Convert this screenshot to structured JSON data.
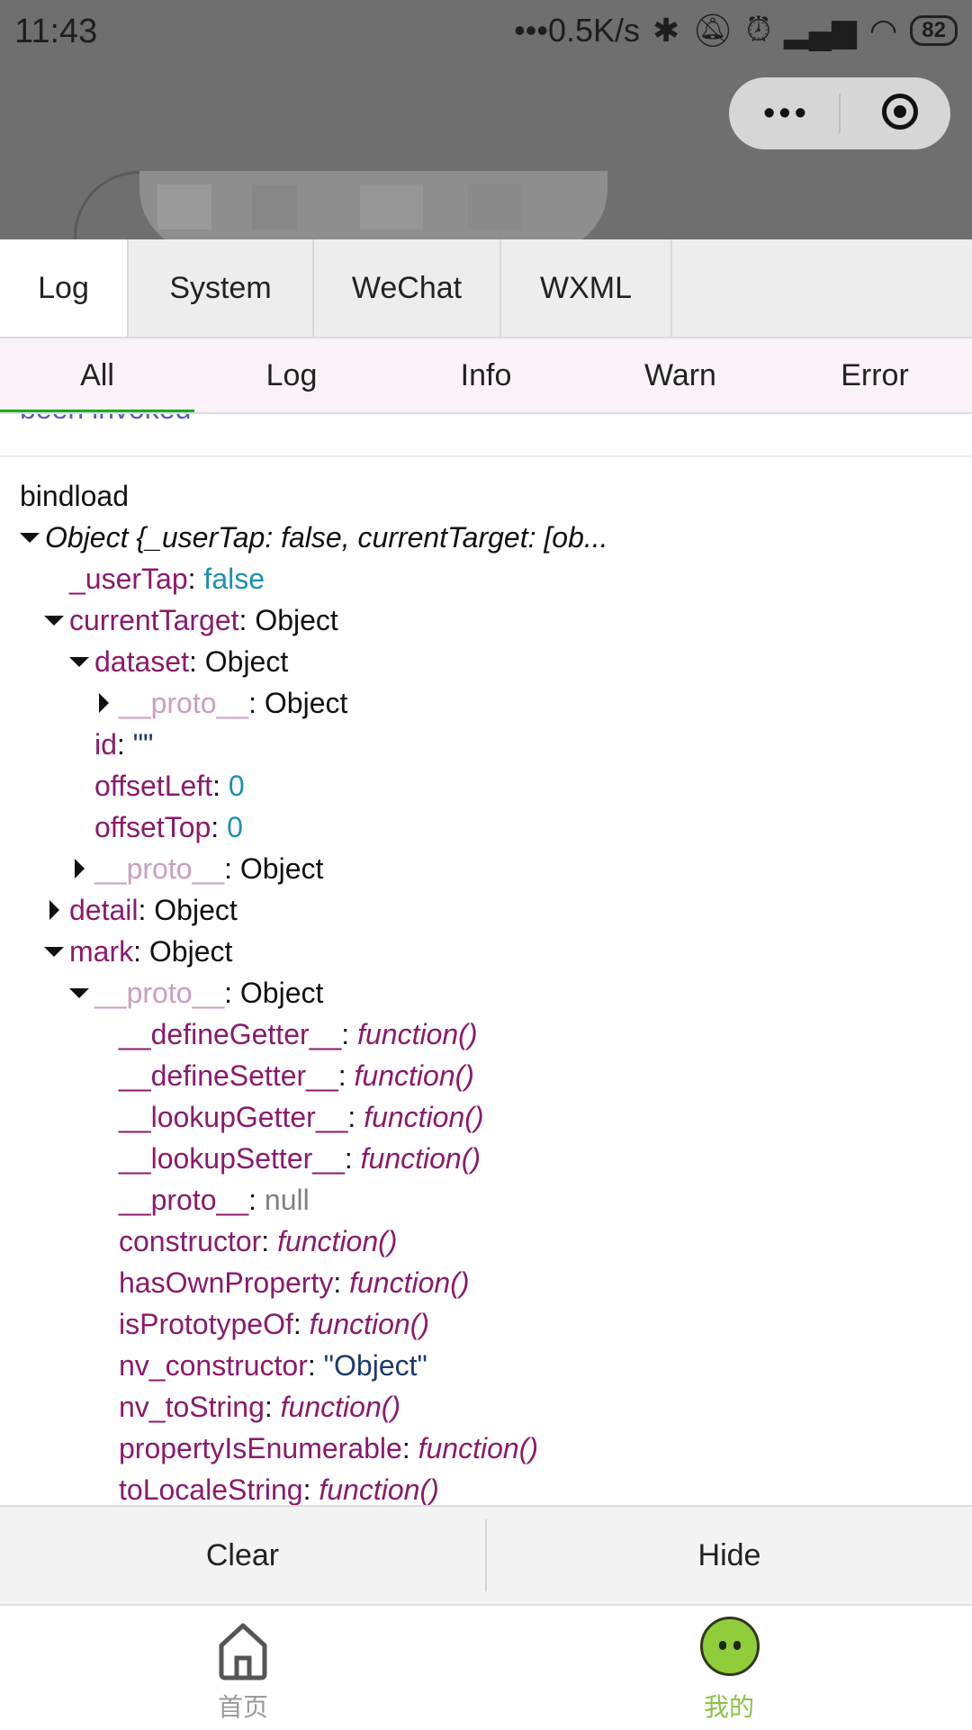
{
  "status_bar": {
    "time": "11:43",
    "net_speed": "•••0.5K/s",
    "battery": "82"
  },
  "capsule": {
    "more_icon": "more-dots-icon",
    "close_icon": "target-icon"
  },
  "vconsole": {
    "tabs": [
      "Log",
      "System",
      "WeChat",
      "WXML"
    ],
    "active_tab": "Log",
    "filters": [
      "All",
      "Log",
      "Info",
      "Warn",
      "Error"
    ],
    "active_filter": "All",
    "partial_previous_text": "been invoked",
    "log_title": "bindload",
    "object_summary": "Object {_userTap: false, currentTarget: [ob...",
    "tree": {
      "userTap_key": "_userTap",
      "userTap_val": "false",
      "currentTarget_key": "currentTarget",
      "object_label": "Object",
      "dataset_key": "dataset",
      "proto_key": "__proto__",
      "id_key": "id",
      "id_val": "\"\"",
      "offsetLeft_key": "offsetLeft",
      "offsetLeft_val": "0",
      "offsetTop_key": "offsetTop",
      "offsetTop_val": "0",
      "detail_key": "detail",
      "mark_key": "mark",
      "fn_label": "function()",
      "null_label": "null",
      "proto_members": [
        "__defineGetter__",
        "__defineSetter__",
        "__lookupGetter__",
        "__lookupSetter__",
        "__proto__",
        "constructor",
        "hasOwnProperty",
        "isPrototypeOf",
        "nv_constructor",
        "nv_toString",
        "propertyIsEnumerable",
        "toLocaleString"
      ],
      "nv_constructor_val": "\"Object\""
    },
    "actions": {
      "clear": "Clear",
      "hide": "Hide"
    }
  },
  "tabbar": {
    "home_label": "首页",
    "me_label": "我的",
    "inactive_color": "#9a9a9a",
    "active_color": "#8bc34a"
  }
}
